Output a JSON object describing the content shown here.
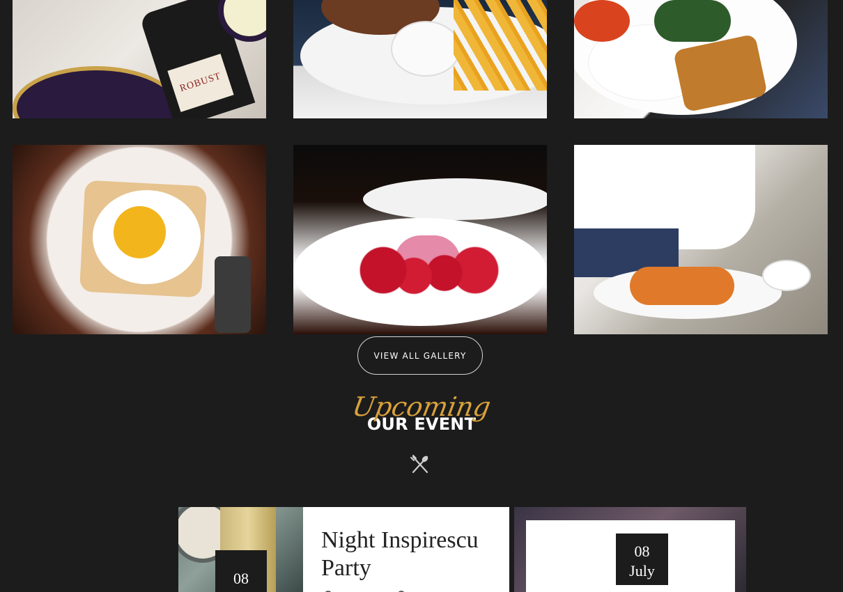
{
  "gallery": {
    "images": [
      {
        "alt": "Wine bottle and place setting",
        "label": "ROBUST"
      },
      {
        "alt": "Burger and fries"
      },
      {
        "alt": "Breakfast plate with eggs and toast"
      },
      {
        "alt": "Fried egg on toast"
      },
      {
        "alt": "Raspberry dessert"
      },
      {
        "alt": "Chef plating a dish"
      }
    ],
    "view_all_label": "VIEW ALL GALLERY"
  },
  "events_section": {
    "script_title": "Upcoming",
    "title": "OUR EVENT",
    "icon": "cutlery-icon"
  },
  "events": [
    {
      "day": "08",
      "title": "Night Inspirescu Party"
    },
    {
      "day": "08",
      "month": "July"
    }
  ],
  "colors": {
    "background": "#1c1c1c",
    "accent": "#d8a13a",
    "white": "#ffffff"
  }
}
